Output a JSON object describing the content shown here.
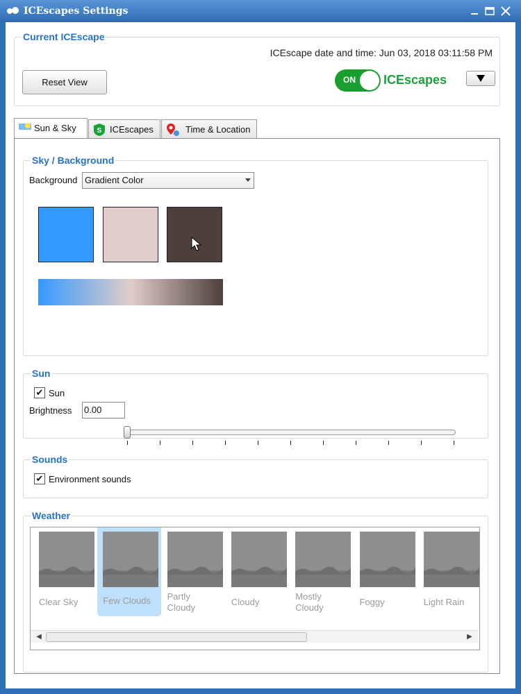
{
  "window": {
    "title": "ICEscapes Settings"
  },
  "current_group": {
    "title": "Current ICEscape",
    "datetime": "ICEscape date and time: Jun 03, 2018  03:11:58 PM",
    "reset_button": "Reset View",
    "toggle_label": "ON",
    "brand": "ICEscapes"
  },
  "tabs": [
    {
      "label": "Sun & Sky",
      "icon": "sky-icon",
      "active": true
    },
    {
      "label": "ICEscapes",
      "icon": "shield-icon",
      "active": false
    },
    {
      "label": "Time & Location",
      "icon": "location-pin-icon",
      "active": false
    }
  ],
  "sky_background": {
    "title": "Sky / Background",
    "background_label": "Background",
    "background_value": "Gradient Color",
    "colors": [
      "#3399ff",
      "#e1cdca",
      "#4d3f3c"
    ]
  },
  "sun": {
    "title": "Sun",
    "checkbox_label": "Sun",
    "checked": true,
    "brightness_label": "Brightness",
    "brightness_value": "0.00",
    "slider_value": 0.0
  },
  "sounds": {
    "title": "Sounds",
    "environment_label": "Environment sounds",
    "checked": true
  },
  "weather": {
    "title": "Weather",
    "items": [
      {
        "label": "Clear Sky",
        "selected": false
      },
      {
        "label": "Few Clouds",
        "selected": true
      },
      {
        "label": "Partly Cloudy",
        "selected": false
      },
      {
        "label": "Cloudy",
        "selected": false
      },
      {
        "label": "Mostly Cloudy",
        "selected": false
      },
      {
        "label": "Foggy",
        "selected": false
      },
      {
        "label": "Light Rain",
        "selected": false
      }
    ]
  }
}
